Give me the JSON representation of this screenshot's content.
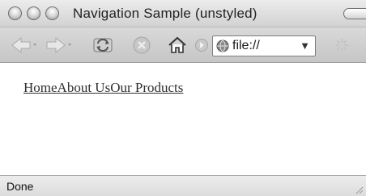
{
  "window": {
    "title": "Navigation Sample (unstyled)"
  },
  "toolbar": {
    "icons": [
      "back-arrow-icon",
      "forward-arrow-icon",
      "reload-icon",
      "stop-icon",
      "home-icon",
      "go-icon",
      "globe-icon",
      "throbber-icon"
    ],
    "url_text": "file://",
    "url_dropdown": "▼"
  },
  "content": {
    "nav_links": [
      "Home",
      "About Us",
      "Our Products"
    ]
  },
  "statusbar": {
    "status": "Done"
  },
  "colors": {
    "chrome": "#d2d2d2",
    "link": "#2f2f2f",
    "page_bg": "#ffffff"
  }
}
